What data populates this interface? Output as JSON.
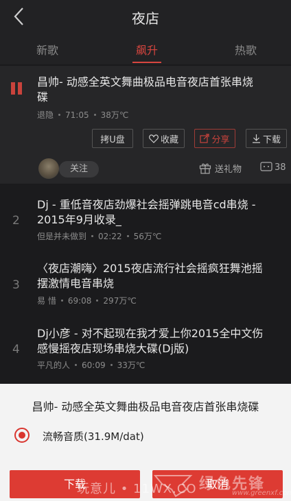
{
  "header": {
    "title": "夜店"
  },
  "tabs": [
    {
      "label": "新歌"
    },
    {
      "label": "飙升"
    },
    {
      "label": "热歌"
    }
  ],
  "active_color": "#d8463f",
  "songs": [
    {
      "index": "",
      "title_line1": "昌帅- 动感全英文舞曲极品电音夜店首张串烧",
      "title_line2": "碟",
      "artist": "退隐",
      "duration": "71:05",
      "plays": "38万℃"
    },
    {
      "index": "2",
      "title_line1": "Dj - 重低音夜店劲爆社会摇弹跳电音cd串烧 -",
      "title_line2": "2015年9月收录_",
      "artist": "但是并未做到",
      "duration": "02:22",
      "plays": "56万℃"
    },
    {
      "index": "3",
      "title_line1": "〈夜店潮嗨〉2015夜店流行社会摇疯狂舞池摇",
      "title_line2": "摆激情电音串烧",
      "artist": "易 惜",
      "duration": "69:08",
      "plays": "297万℃"
    },
    {
      "index": "4",
      "title_line1": "Dj小彦 - 对不起现在我才爱上你2015全中文伤",
      "title_line2": "感慢摇夜店现场串烧大碟(Dj版)",
      "artist": "平凡的人",
      "duration": "60:09",
      "plays": "33万℃"
    }
  ],
  "actions": {
    "copy_usb": "拷U盘",
    "favorite": "收藏",
    "share": "分享",
    "download": "下载"
  },
  "social": {
    "follow": "关注",
    "gift": "送礼物",
    "comments": "38"
  },
  "sheet": {
    "title": "昌帅- 动感全英文舞曲极品电音夜店首张串烧碟",
    "quality_option": "流畅音质(31.9M/dat)",
    "download_button": "下载",
    "cancel_button": "取消"
  },
  "watermark": {
    "left": "玩意儿 • 11WX.CO",
    "brand": "绿色先锋",
    "url": "www.greenxf.com"
  }
}
